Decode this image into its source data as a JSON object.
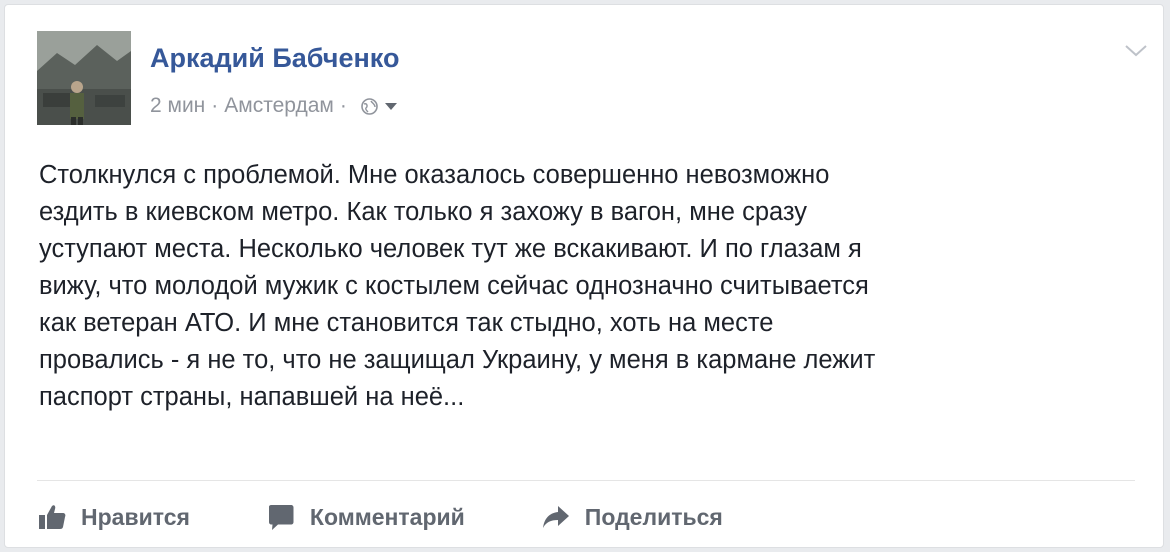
{
  "post": {
    "author": "Аркадий Бабченко",
    "time": "2 мин",
    "separator": "·",
    "location": "Амстердам",
    "privacy_icon": "globe-icon",
    "text": "Столкнулся с проблемой. Мне оказалось совершенно невозможно\nездить в киевском метро. Как только я захожу в вагон, мне сразу\nуступают места. Несколько человек тут же вскакивают. И по глазам я\nвижу, что молодой мужик с костылем сейчас однозначно считывается\nкак ветеран АТО. И мне становится так стыдно, хоть на месте\nпровались - я не то, что не защищал Украину, у меня в кармане лежит\nпаспорт страны, напавшей на неё..."
  },
  "actions": {
    "like": "Нравится",
    "comment": "Комментарий",
    "share": "Поделиться"
  },
  "colors": {
    "author_link": "#365899",
    "meta_text": "#90949c",
    "body_text": "#1d2129",
    "action_text": "#616770"
  }
}
